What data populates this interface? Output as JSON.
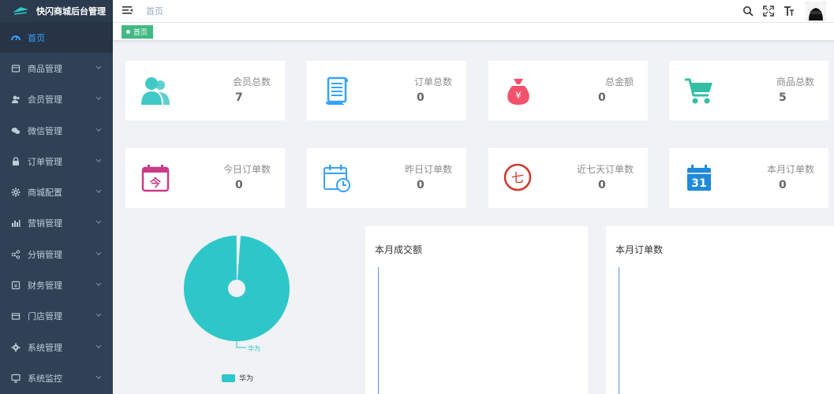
{
  "app": {
    "title": "快闪商城后台管理"
  },
  "sidebar": {
    "items": [
      {
        "label": "首页",
        "icon": "dashboard-icon",
        "active": true
      },
      {
        "label": "商品管理",
        "icon": "goods-icon"
      },
      {
        "label": "会员管理",
        "icon": "members-icon"
      },
      {
        "label": "微信管理",
        "icon": "wechat-icon"
      },
      {
        "label": "订单管理",
        "icon": "lock-icon"
      },
      {
        "label": "商城配置",
        "icon": "gear-icon"
      },
      {
        "label": "营销管理",
        "icon": "bar-chart-icon"
      },
      {
        "label": "分销管理",
        "icon": "share-icon"
      },
      {
        "label": "财务管理",
        "icon": "finance-icon"
      },
      {
        "label": "门店管理",
        "icon": "store-icon"
      },
      {
        "label": "系统管理",
        "icon": "settings-icon"
      },
      {
        "label": "系统监控",
        "icon": "monitor-icon"
      }
    ]
  },
  "header": {
    "breadcrumb": "首页"
  },
  "tags": {
    "active": "首页"
  },
  "stats_row1": [
    {
      "label": "会员总数",
      "value": "7",
      "icon": "users-icon",
      "color": "#40c9c6"
    },
    {
      "label": "订单总数",
      "value": "0",
      "icon": "scroll-icon",
      "color": "#36a3f7"
    },
    {
      "label": "总金额",
      "value": "0",
      "icon": "money-bag-icon",
      "color": "#f4516c"
    },
    {
      "label": "商品总数",
      "value": "5",
      "icon": "cart-icon",
      "color": "#34bfa3"
    }
  ],
  "stats_row2": [
    {
      "label": "今日订单数",
      "value": "0",
      "icon": "today-calendar-icon",
      "color": "#c93b87",
      "glyph": "今"
    },
    {
      "label": "昨日订单数",
      "value": "0",
      "icon": "calendar-clock-icon",
      "color": "#36a3f7"
    },
    {
      "label": "近七天订单数",
      "value": "0",
      "icon": "seven-circle-icon",
      "color": "#d0362b",
      "glyph": "七"
    },
    {
      "label": "本月订单数",
      "value": "0",
      "icon": "calendar-31-icon",
      "color": "#1f8ad8",
      "glyph": "31"
    }
  ],
  "pie": {
    "label": "华为",
    "legend": "华为",
    "color": "#2ec7c9"
  },
  "chart_data": [
    {
      "type": "pie",
      "categories": [
        "华为"
      ],
      "values": [
        100
      ],
      "legend": [
        "华为"
      ]
    },
    {
      "type": "line",
      "title": "本月成交额",
      "x": [],
      "series": []
    },
    {
      "type": "line",
      "title": "本月订单数",
      "x": [],
      "series": []
    }
  ],
  "panels": {
    "turnover_title": "本月成交额",
    "orders_title": "本月订单数"
  }
}
